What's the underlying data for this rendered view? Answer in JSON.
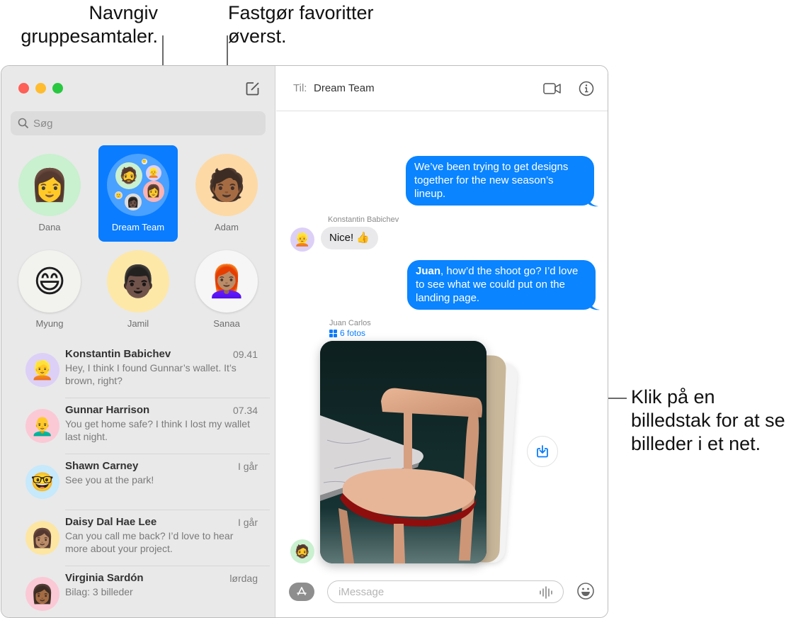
{
  "callouts": {
    "name_groups": [
      "Navngiv",
      "gruppesamtaler."
    ],
    "pin_favorites": [
      "Fastgør favoritter",
      "øverst."
    ],
    "photo_stack": [
      "Klik på en",
      "billedstak for at se",
      "billeder i et net."
    ]
  },
  "window": {
    "traffic_lights": {
      "close": "#fe5f57",
      "minimize": "#febc2e",
      "zoom": "#28c840"
    },
    "accent_color": "#0a7cff"
  },
  "sidebar": {
    "compose_icon": "compose-icon",
    "search": {
      "placeholder": "Søg",
      "value": ""
    },
    "pinned": [
      {
        "name": "Dana",
        "emoji": "👩",
        "bg": "#c9f0cf",
        "selected": false
      },
      {
        "name": "Dream Team",
        "emoji": "",
        "bg": "#4aa1ff",
        "selected": true
      },
      {
        "name": "Adam",
        "emoji": "🧑🏾",
        "bg": "#fdd9a6",
        "selected": false
      },
      {
        "name": "Myung",
        "emoji": "😄",
        "bg": "#f2f2ee",
        "selected": false
      },
      {
        "name": "Jamil",
        "emoji": "👨🏿",
        "bg": "#fde8a8",
        "selected": false
      },
      {
        "name": "Sanaa",
        "emoji": "👩🏽‍🦰",
        "bg": "#f6f6f6",
        "selected": false
      }
    ],
    "conversations": [
      {
        "name": "Konstantin Babichev",
        "time": "09.41",
        "preview": "Hey, I think I found Gunnar’s wallet. It’s brown, right?",
        "emoji": "👱",
        "bg": "#dcd0f7"
      },
      {
        "name": "Gunnar Harrison",
        "time": "07.34",
        "preview": "You get home safe? I think I lost my wallet last night.",
        "emoji": "👨‍🦲",
        "bg": "#fbc9d6"
      },
      {
        "name": "Shawn Carney",
        "time": "I går",
        "preview": "See you at the park!",
        "emoji": "🤓",
        "bg": "#c6e9fb"
      },
      {
        "name": "Daisy Dal Hae Lee",
        "time": "I går",
        "preview": "Can you call me back? I’d love to hear more about your project.",
        "emoji": "👩🏽",
        "bg": "#fde6a2"
      },
      {
        "name": "Virginia Sardón",
        "time": "lørdag",
        "preview": "Bilag:  3 billeder",
        "emoji": "👩🏾",
        "bg": "#fbc9d6"
      }
    ]
  },
  "chat": {
    "to_label": "Til:",
    "to_value": "Dream Team",
    "messages": [
      {
        "direction": "out",
        "text": "We’ve been trying to get designs together for the new season’s lineup."
      },
      {
        "direction": "in",
        "sender": "Konstantin Babichev",
        "text": "Nice! 👍",
        "avatar_emoji": "👱",
        "avatar_bg": "#dcd0f7"
      },
      {
        "direction": "out",
        "mention": "Juan",
        "text": ", how’d the shoot go? I’d love to see what we could put on the landing page."
      },
      {
        "direction": "in",
        "sender": "Juan Carlos",
        "photo_count_label": "6 fotos",
        "avatar_emoji": "🧔",
        "avatar_bg": "#c9f0cf"
      }
    ],
    "composer": {
      "placeholder": "iMessage",
      "value": ""
    }
  }
}
